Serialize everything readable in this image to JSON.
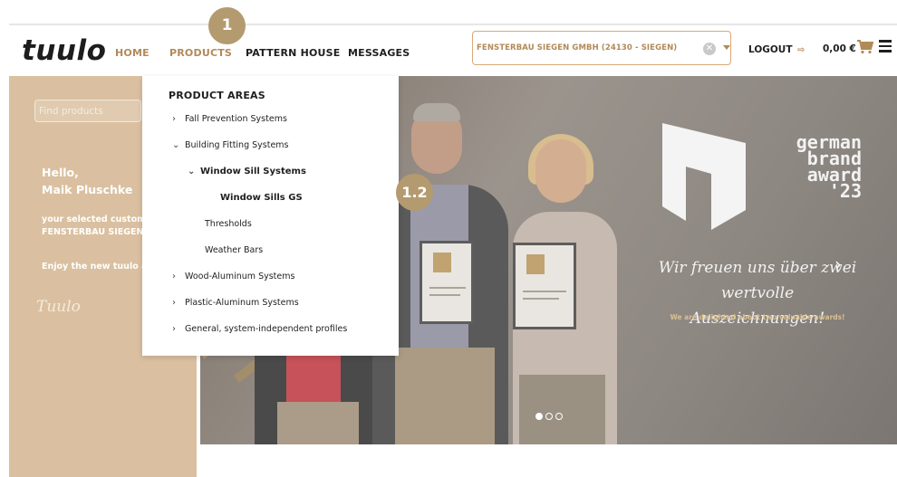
{
  "header": {
    "logo": "tuulo",
    "nav": {
      "home": "HOME",
      "products": "PRODUCTS",
      "pattern_house": "PATTERN HOUSE",
      "messages": "MESSAGES"
    },
    "customer_select_value": "FENSTERBAU SIEGEN GMBH (24130 - SIEGEN)",
    "clear_symbol": "✕",
    "logout_label": "LOGOUT",
    "logout_icon": "⇨",
    "cart_total": "0,00 €"
  },
  "badges": {
    "badge_1": "1",
    "badge_2": "1.2"
  },
  "sidebar": {
    "search_placeholder": "Find products",
    "greeting_line1": "Hello,",
    "greeting_line2": "Maik Pluschke",
    "selected_customer_line1": "your selected custom",
    "selected_customer_line2": "FENSTERBAU SIEGEN",
    "enjoy": "Enjoy the new tuulo a",
    "signature": "Tuulo"
  },
  "dropdown": {
    "title": "PRODUCT AREAS",
    "items": [
      {
        "label": "Fall Prevention Systems",
        "chevron": "›"
      },
      {
        "label": "Building Fitting Systems",
        "chevron": "⌄"
      },
      {
        "label": "Window Sill Systems",
        "chevron": "⌄"
      },
      {
        "label": "Window Sills GS",
        "chevron": ""
      },
      {
        "label": "Thresholds",
        "chevron": ""
      },
      {
        "label": "Weather Bars",
        "chevron": ""
      },
      {
        "label": "Wood-Aluminum Systems",
        "chevron": "›"
      },
      {
        "label": "Plastic-Aluminum Systems",
        "chevron": "›"
      },
      {
        "label": "General, system-independent profiles",
        "chevron": "›"
      }
    ]
  },
  "hero": {
    "award_line1": "german",
    "award_line2": "brand",
    "award_line3": "award",
    "award_line4": "'23",
    "script_line1": "Wir freuen uns über zwei",
    "script_line2": "wertvolle Auszeichnungen!",
    "caption": "We are delighted about two valuable awards!",
    "next_arrow": "›",
    "slide_count": 3,
    "active_slide": 1
  },
  "colors": {
    "accent": "#b28a58",
    "sidebar_bg": "#dac0a0",
    "badge": "#b49a6f"
  }
}
